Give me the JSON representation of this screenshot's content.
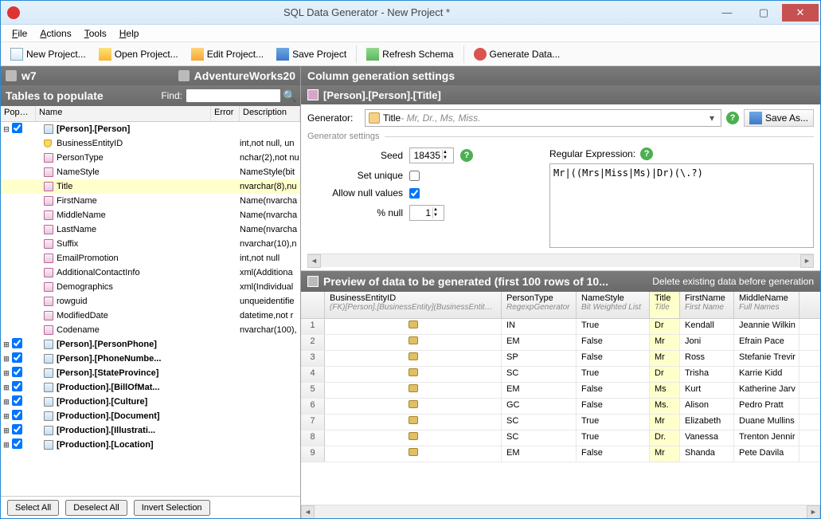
{
  "window": {
    "title": "SQL Data Generator  - New Project *"
  },
  "menu": {
    "file": "File",
    "actions": "Actions",
    "tools": "Tools",
    "help": "Help"
  },
  "toolbar": {
    "new": "New Project...",
    "open": "Open Project...",
    "edit": "Edit Project...",
    "save": "Save Project",
    "refresh": "Refresh Schema",
    "gen": "Generate Data..."
  },
  "serverbar": {
    "server": "w7",
    "db": "AdventureWorks20"
  },
  "tpop": {
    "title": "Tables to populate",
    "find_label": "Find:",
    "find_value": ""
  },
  "tree_hdr": {
    "pop": "Popul…",
    "name": "Name",
    "err": "Error",
    "desc": "Description"
  },
  "tree": {
    "tables": [
      {
        "name": "[Person].[Person]",
        "expanded": true,
        "columns": [
          {
            "icon": "key",
            "name": "BusinessEntityID",
            "desc": "int,not null, un"
          },
          {
            "icon": "col",
            "name": "PersonType",
            "desc": "nchar(2),not nu"
          },
          {
            "icon": "col",
            "name": "NameStyle",
            "desc": "NameStyle(bit"
          },
          {
            "icon": "col",
            "name": "Title",
            "desc": "nvarchar(8),nu",
            "selected": true
          },
          {
            "icon": "col",
            "name": "FirstName",
            "desc": "Name(nvarcha"
          },
          {
            "icon": "col",
            "name": "MiddleName",
            "desc": "Name(nvarcha"
          },
          {
            "icon": "col",
            "name": "LastName",
            "desc": "Name(nvarcha"
          },
          {
            "icon": "col",
            "name": "Suffix",
            "desc": "nvarchar(10),n"
          },
          {
            "icon": "col",
            "name": "EmailPromotion",
            "desc": "int,not null"
          },
          {
            "icon": "col",
            "name": "AdditionalContactInfo",
            "desc": "xml(Additiona"
          },
          {
            "icon": "col",
            "name": "Demographics",
            "desc": "xml(Individual"
          },
          {
            "icon": "col",
            "name": "rowguid",
            "desc": "unqueidentifie"
          },
          {
            "icon": "col",
            "name": "ModifiedDate",
            "desc": "datetime,not r"
          },
          {
            "icon": "col",
            "name": "Codename",
            "desc": "nvarchar(100),"
          }
        ]
      },
      {
        "name": "[Person].[PersonPhone]"
      },
      {
        "name": "[Person].[PhoneNumbe..."
      },
      {
        "name": "[Person].[StateProvince]"
      },
      {
        "name": "[Production].[BillOfMat..."
      },
      {
        "name": "[Production].[Culture]"
      },
      {
        "name": "[Production].[Document]"
      },
      {
        "name": "[Production].[Illustrati..."
      },
      {
        "name": "[Production].[Location]"
      }
    ]
  },
  "bottom": {
    "select_all": "Select All",
    "deselect_all": "Deselect All",
    "invert": "Invert Selection"
  },
  "right": {
    "hdr": "Column generation settings",
    "colname": "[Person].[Person].[Title]",
    "gen_label": "Generator:",
    "gen_name": "Title",
    "gen_desc": " - Mr, Dr., Ms, Miss.",
    "save_as": "Save As...",
    "fs_title": "Generator settings",
    "seed_label": "Seed",
    "seed": "18435",
    "unique_label": "Set unique",
    "unique": false,
    "allow_null_label": "Allow null values",
    "allow_null": true,
    "pct_null_label": "% null",
    "pct_null": "1",
    "regex_label": "Regular Expression:",
    "regex": "Mr|((Mrs|Miss|Ms)|Dr)(\\.?)"
  },
  "preview": {
    "hdr": "Preview of data to be generated (first 100 rows of 10...",
    "link": "Delete existing data before generation",
    "columns": [
      {
        "h1": "BusinessEntityID",
        "h2": "(FK)[Person].[BusinessEntity](BusinessEntityID)",
        "w": "w-beid",
        "center": true
      },
      {
        "h1": "PersonType",
        "h2": "RegexpGenerator",
        "w": "w-ptype"
      },
      {
        "h1": "NameStyle",
        "h2": "Bit Weighted List",
        "w": "w-nstyle"
      },
      {
        "h1": "Title",
        "h2": "Title",
        "w": "w-title",
        "sel": true
      },
      {
        "h1": "FirstName",
        "h2": "First Name",
        "w": "w-fname"
      },
      {
        "h1": "MiddleName",
        "h2": "Full Names",
        "w": "w-mname"
      }
    ],
    "rows": [
      {
        "n": 1,
        "beid": "key",
        "ptype": "IN",
        "nstyle": "True",
        "title": "Dr",
        "fname": "Kendall",
        "mname": "Jeannie Wilkin"
      },
      {
        "n": 2,
        "beid": "key",
        "ptype": "EM",
        "nstyle": "False",
        "title": "Mr",
        "fname": "Joni",
        "mname": "Efrain Pace"
      },
      {
        "n": 3,
        "beid": "key",
        "ptype": "SP",
        "nstyle": "False",
        "title": "Mr",
        "fname": "Ross",
        "mname": "Stefanie Trevir"
      },
      {
        "n": 4,
        "beid": "key",
        "ptype": "SC",
        "nstyle": "True",
        "title": "Dr",
        "fname": "Trisha",
        "mname": "Karrie Kidd"
      },
      {
        "n": 5,
        "beid": "key",
        "ptype": "EM",
        "nstyle": "False",
        "title": "Ms",
        "fname": "Kurt",
        "mname": "Katherine Jarv"
      },
      {
        "n": 6,
        "beid": "key",
        "ptype": "GC",
        "nstyle": "False",
        "title": "Ms.",
        "fname": "Alison",
        "mname": "Pedro Pratt"
      },
      {
        "n": 7,
        "beid": "key",
        "ptype": "SC",
        "nstyle": "True",
        "title": "Mr",
        "fname": "Elizabeth",
        "mname": "Duane Mullins"
      },
      {
        "n": 8,
        "beid": "key",
        "ptype": "SC",
        "nstyle": "True",
        "title": "Dr.",
        "fname": "Vanessa",
        "mname": "Trenton Jennir"
      },
      {
        "n": 9,
        "beid": "key",
        "ptype": "EM",
        "nstyle": "False",
        "title": "Mr",
        "fname": "Shanda",
        "mname": "Pete Davila"
      }
    ]
  }
}
